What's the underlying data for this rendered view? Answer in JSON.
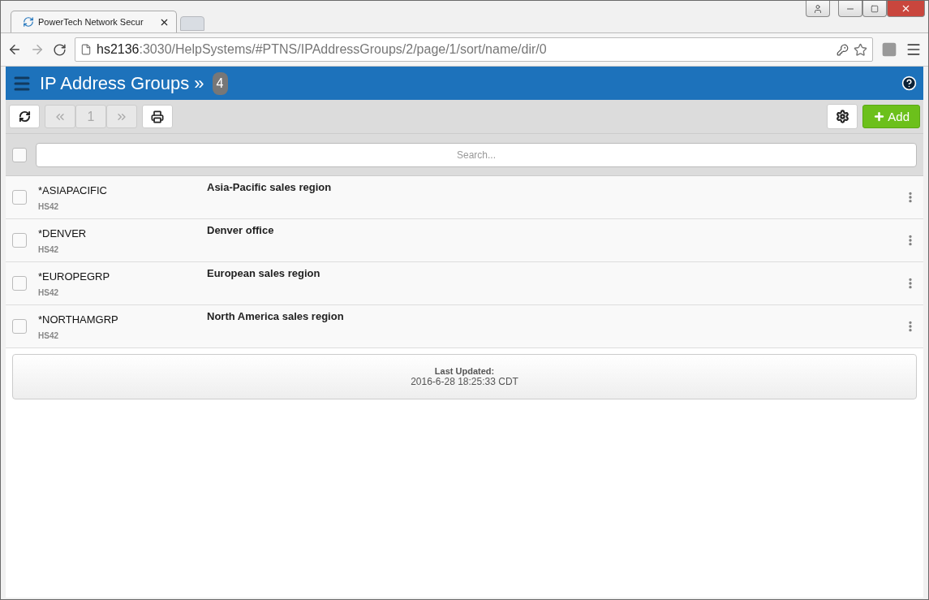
{
  "browser": {
    "tab_title": "PowerTech Network Secur",
    "url_host": "hs2136",
    "url_path": ":3030/HelpSystems/#PTNS/IPAddressGroups/2/page/1/sort/name/dir/0"
  },
  "header": {
    "title": "IP Address Groups »",
    "count": "4"
  },
  "toolbar": {
    "page": "1",
    "add_label": "Add"
  },
  "search": {
    "placeholder": "Search...",
    "select_all_checked": false
  },
  "rows": [
    {
      "name": "*ASIAPACIFIC",
      "owner": "HS42",
      "description": "Asia-Pacific sales region",
      "checked": false
    },
    {
      "name": "*DENVER",
      "owner": "HS42",
      "description": "Denver office",
      "checked": false
    },
    {
      "name": "*EUROPEGRP",
      "owner": "HS42",
      "description": "European sales region",
      "checked": false
    },
    {
      "name": "*NORTHAMGRP",
      "owner": "HS42",
      "description": "North America sales region",
      "checked": false
    }
  ],
  "footer": {
    "label": "Last Updated:",
    "timestamp": "2016-6-28 18:25:33 CDT"
  }
}
